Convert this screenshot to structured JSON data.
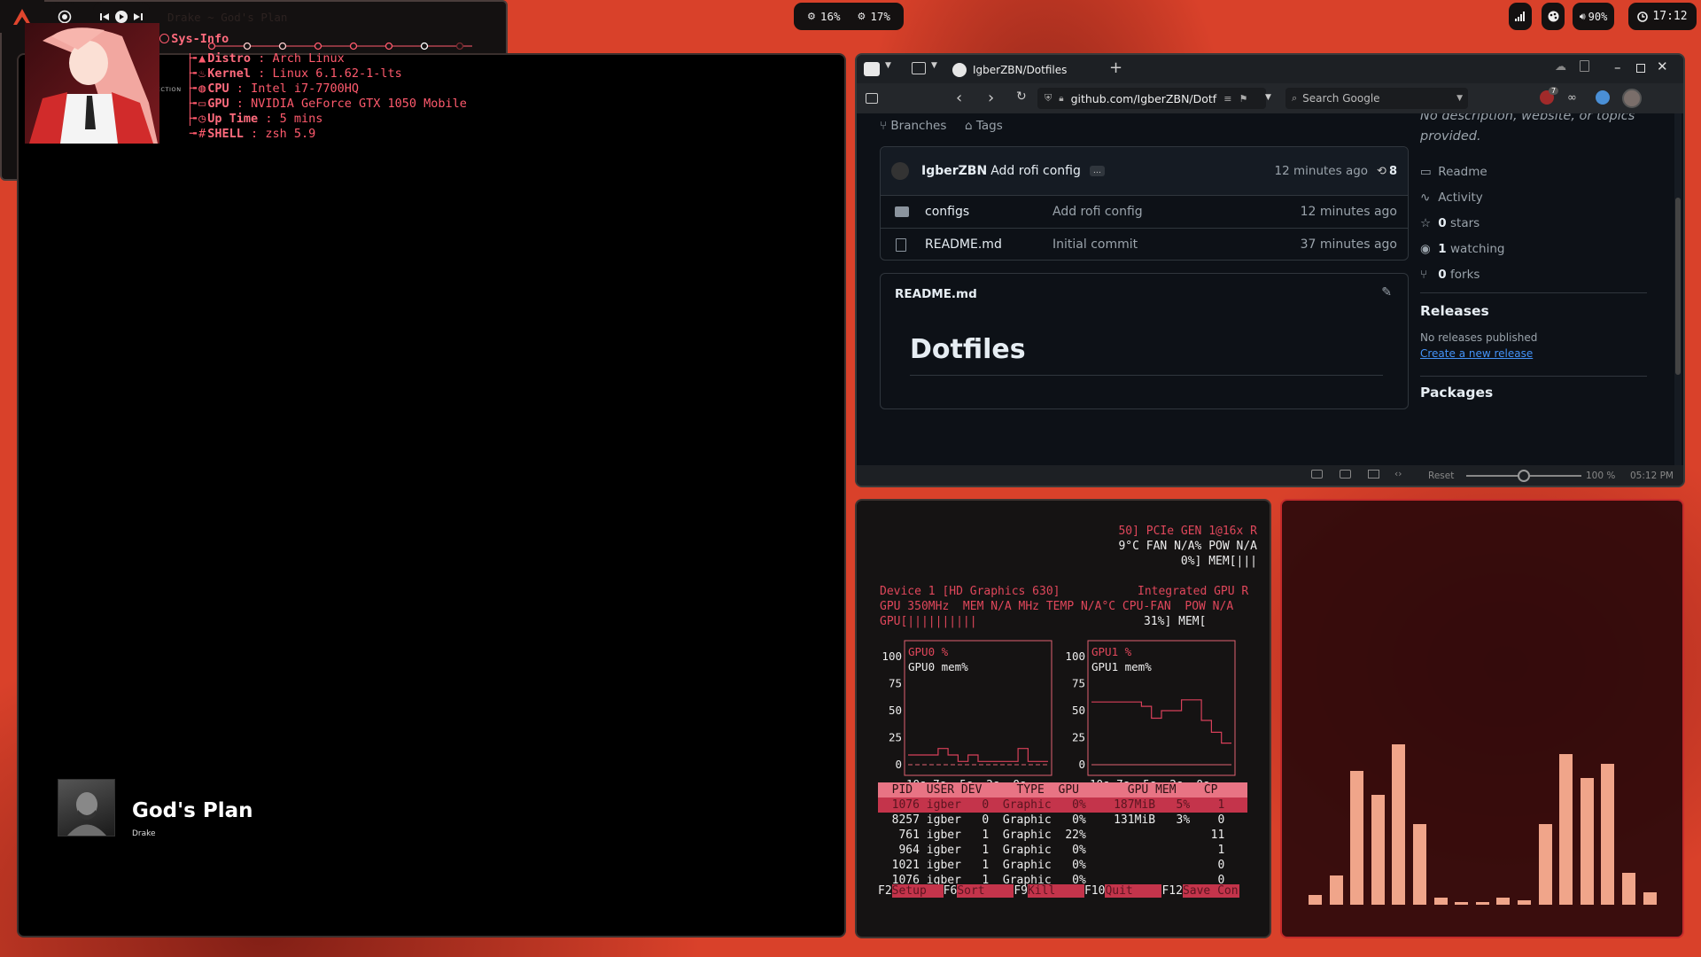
{
  "topbar": {
    "now_playing": "Drake ~ God's Plan",
    "cpu": "16%",
    "mem": "17%",
    "volume": "90%",
    "clock": "17:12"
  },
  "spotify": {
    "header": "PLAYING FROM COLLECTION",
    "title": "God's Plan",
    "artist": "Drake"
  },
  "browser": {
    "tab_title": "IgberZBN/Dotfiles",
    "url": "github.com/IgberZBN/Dotf",
    "search_placeholder": "Search Google",
    "badge": "7",
    "branches": "Branches",
    "tags": "Tags",
    "commit": {
      "user": "IgberZBN",
      "message": "Add rofi config",
      "time": "12 minutes ago",
      "count": "8"
    },
    "files": [
      {
        "name": "configs",
        "message": "Add rofi config",
        "time": "12 minutes ago",
        "kind": "folder"
      },
      {
        "name": "README.md",
        "message": "Initial commit",
        "time": "37 minutes ago",
        "kind": "file"
      }
    ],
    "readme_label": "README.md",
    "readme_heading": "Dotfiles",
    "about": "No description, website, or topics provided.",
    "sidebar": [
      {
        "icon": "book-icon",
        "label": "Readme"
      },
      {
        "icon": "pulse-icon",
        "label": "Activity"
      },
      {
        "icon": "star-icon",
        "count": "0",
        "label": "stars"
      },
      {
        "icon": "eye-icon",
        "count": "1",
        "label": "watching"
      },
      {
        "icon": "fork-icon",
        "count": "0",
        "label": "forks"
      }
    ],
    "releases": "Releases",
    "no_releases": "No releases published",
    "create_release": "Create a new release",
    "packages": "Packages",
    "status": {
      "reset": "Reset",
      "zoom": "100 %",
      "time": "05:12 PM",
      "zoom_level": 0.5
    }
  },
  "terminal": {
    "l1": "50] PCIe GEN 1@16x R",
    "l2": "9°C FAN N/A% POW N/A",
    "l3": "0%] MEM[|||",
    "d1a": "Device 1 [HD Graphics 630]",
    "d1b": "Integrated GPU R",
    "d2": "GPU 350MHz  MEM N/A MHz TEMP N/A°C CPU-FAN  POW N/A",
    "d3a": "GPU[||||||||||",
    "d3b": "31%] MEM[",
    "g0_title": "GPU0 %",
    "g0_sub": "GPU0 mem%",
    "g1_title": "GPU1 %",
    "g1_sub": "GPU1 mem%",
    "yticks": [
      "100",
      "75",
      "50",
      "25",
      "0"
    ],
    "xticks": "10s—7s——5s——2s——0s",
    "gpu0_series": [
      9,
      9,
      9,
      15,
      9,
      3,
      9,
      3,
      3,
      3,
      3,
      15,
      3,
      3
    ],
    "gpu1_mem_series": [
      58,
      58,
      58,
      58,
      58,
      54,
      43,
      50,
      50,
      60,
      60,
      41,
      30,
      20
    ],
    "header": "  PID  USER DEV     TYPE  GPU       GPU MEM    CP",
    "rows": [
      "  1076 igber   0  Graphic   0%    187MiB   5%    1",
      "  8257 igber   0  Graphic   0%    131MiB   3%    0",
      "   761 igber   1  Graphic  22%                  11",
      "   964 igber   1  Graphic   0%                   1",
      "  1021 igber   1  Graphic   0%                   0",
      "  1076 igber   1  Graphic   0%                   0"
    ],
    "fkeys": [
      {
        "k": "F2",
        "l": "Setup"
      },
      {
        "k": "F6",
        "l": "Sort"
      },
      {
        "k": "F9",
        "l": "Kill"
      },
      {
        "k": "F10",
        "l": "Quit"
      },
      {
        "k": "F12",
        "l": "Save Con"
      }
    ]
  },
  "sysinfo": {
    "title": "Sys-Info",
    "items": [
      {
        "icon": "arch-icon",
        "key": "Distro",
        "val": "Arch Linux"
      },
      {
        "icon": "flame-icon",
        "key": "Kernel",
        "val": "Linux 6.1.62-1-lts"
      },
      {
        "icon": "cpu-icon",
        "key": "CPU",
        "val": "Intel i7-7700HQ"
      },
      {
        "icon": "monitor-icon",
        "key": "GPU",
        "val": "NVIDIA GeForce GTX 1050 Mobile"
      },
      {
        "icon": "clock-icon",
        "key": "Up Time",
        "val": "5 mins"
      },
      {
        "icon": "hash-icon",
        "key": "SHELL",
        "val": "zsh 5.9"
      }
    ]
  },
  "visualizer": {
    "levels": [
      4,
      12,
      55,
      45,
      66,
      33,
      3,
      1,
      1,
      3,
      2,
      33,
      62,
      52,
      58,
      13,
      5
    ]
  }
}
